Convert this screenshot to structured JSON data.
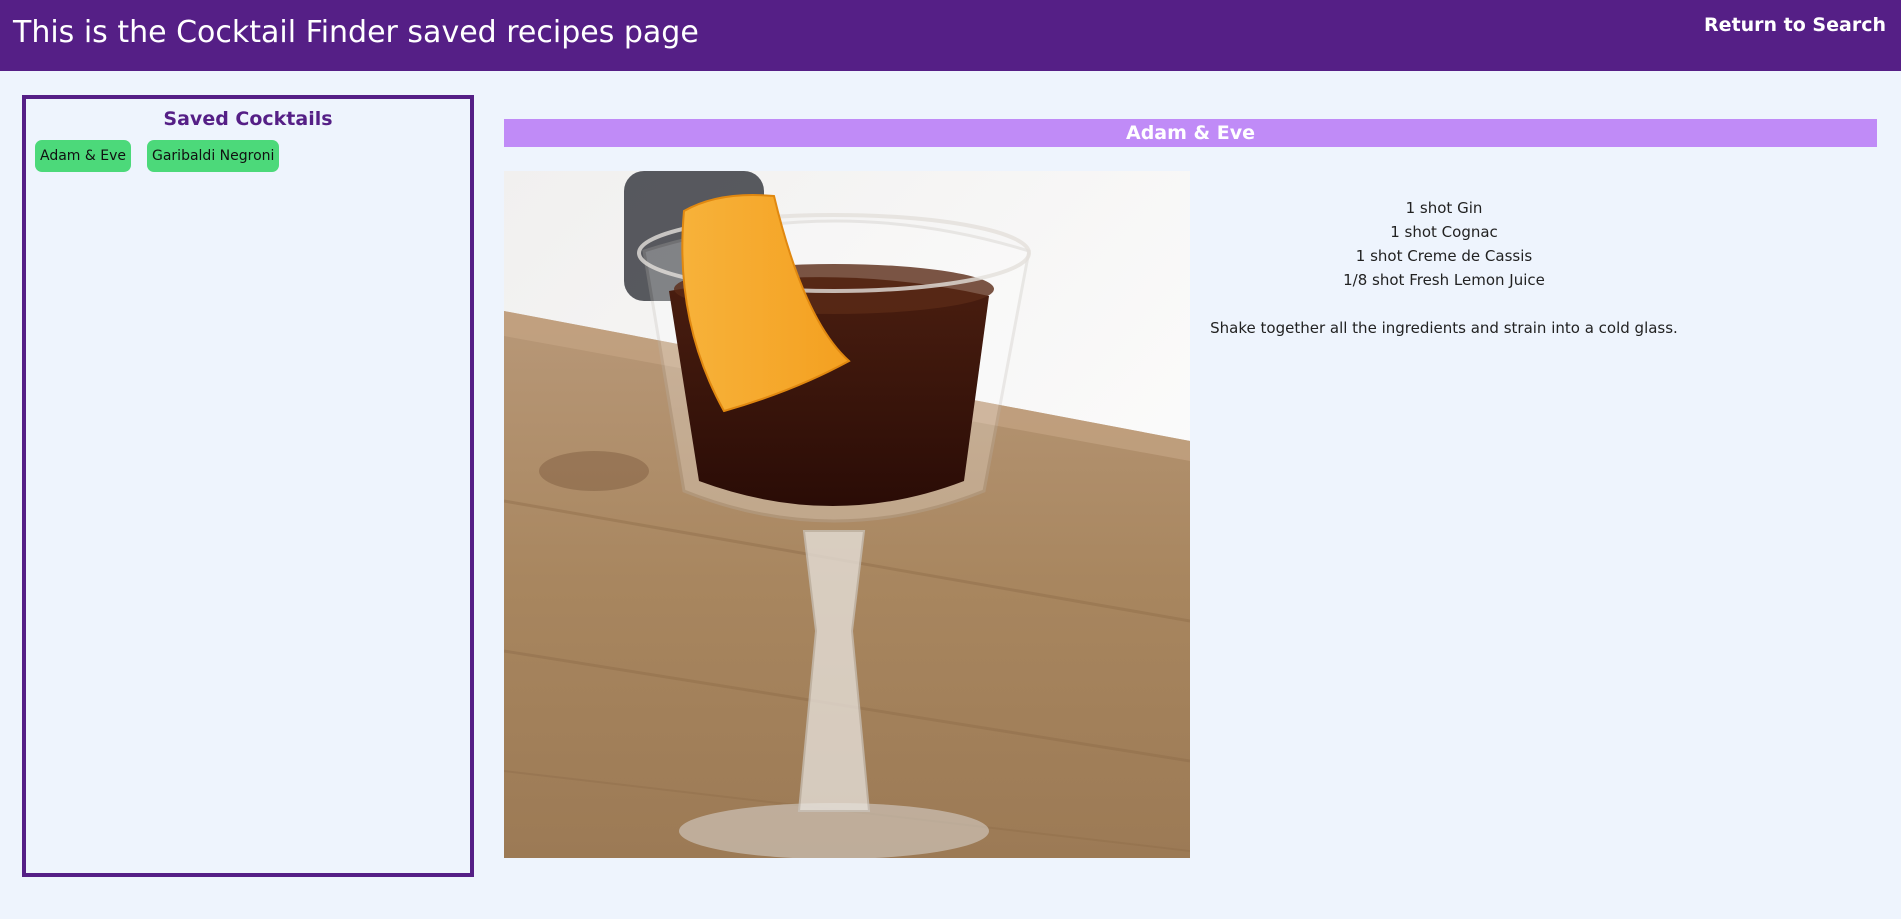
{
  "header": {
    "title": "This is the Cocktail Finder saved recipes page",
    "return_label": "Return to Search"
  },
  "sidebar": {
    "title": "Saved Cocktails",
    "items": [
      {
        "label": "Adam & Eve"
      },
      {
        "label": "Garibaldi Negroni"
      }
    ]
  },
  "recipe": {
    "name": "Adam & Eve",
    "ingredients": [
      "1 shot Gin",
      "1 shot Cognac",
      "1 shot Creme de Cassis",
      "1/8 shot Fresh Lemon Juice"
    ],
    "instructions": "Shake together all the ingredients and strain into a cold glass."
  },
  "colors": {
    "header_bg": "#551f86",
    "page_bg": "#eef4fd",
    "accent": "#c08bf7",
    "saved_button": "#4cd97a"
  },
  "icons": {
    "photo": "cocktail-photo"
  }
}
